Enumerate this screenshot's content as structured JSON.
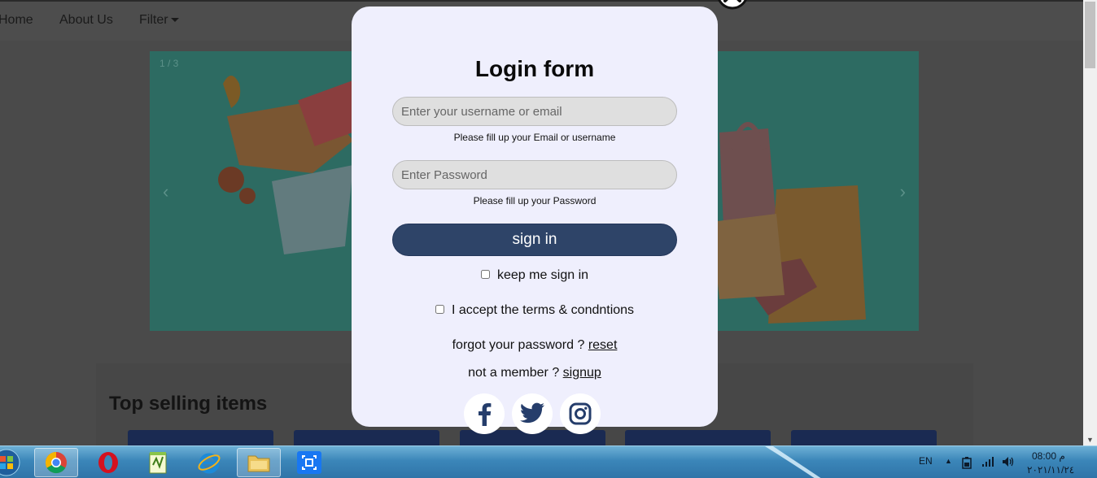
{
  "nav": {
    "home": "Home",
    "about": "About Us",
    "filter": "Filter"
  },
  "carousel": {
    "counter": "1 / 3",
    "prev": "‹",
    "next": "›"
  },
  "section": {
    "title": "Top selling items"
  },
  "modal": {
    "title": "Login form",
    "username_placeholder": "Enter your username or email",
    "username_hint": "Please fill up your Email or username",
    "password_placeholder": "Enter Password",
    "password_hint": "Please fill up your Password",
    "signin_label": "sign in",
    "keep_label": "keep me sign in",
    "terms_label": "I accept the terms & condntions",
    "forgot_text": "forgot your password ?",
    "reset_link": "reset",
    "member_text": "not a member ?",
    "signup_link": "signup",
    "social": [
      "facebook-icon",
      "twitter-icon",
      "instagram-icon"
    ]
  },
  "colors": {
    "modal_bg": "#efeffd",
    "signin_bg": "#2e4468",
    "social_icon": "#253d6b",
    "overlay": "#4a4a4a"
  },
  "taskbar": {
    "apps": [
      "start-orb-icon",
      "chrome-icon",
      "opera-icon",
      "notepad-plus-icon",
      "internet-explorer-icon",
      "file-explorer-icon",
      "snipping-tool-icon"
    ],
    "language": "EN",
    "time": "08:00 م",
    "date": "٢٠٢١/١١/٢٤"
  }
}
